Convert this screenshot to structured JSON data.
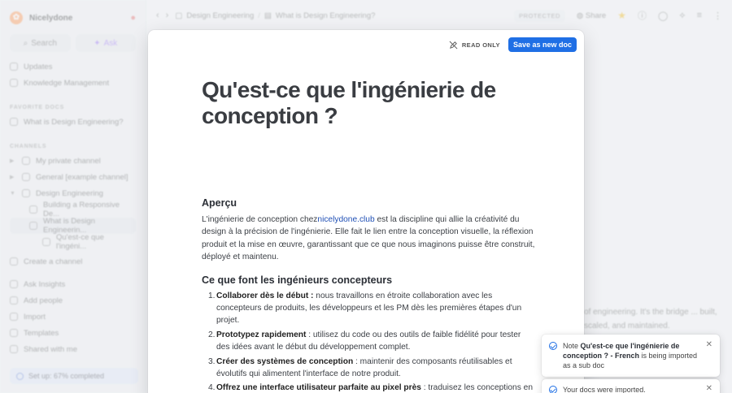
{
  "sidebar": {
    "brand": "Nicelydone",
    "search_label": "Search",
    "ask_label": "Ask",
    "nav": [
      {
        "label": "Updates"
      },
      {
        "label": "Knowledge Management"
      }
    ],
    "favorites_title": "FAVORITE DOCS",
    "favorites": [
      {
        "label": "What is Design Engineering?"
      }
    ],
    "channels_title": "CHANNELS",
    "channels": [
      {
        "label": "My private channel"
      },
      {
        "label": "General [example channel]"
      },
      {
        "label": "Design Engineering"
      }
    ],
    "subdocs": [
      {
        "label": "Building a Responsive De..."
      },
      {
        "label": "What is Design Engineerin..."
      },
      {
        "label": "Qu'est-ce que l'ingéni..."
      }
    ],
    "create_channel": "Create a channel",
    "bottom_items": [
      {
        "label": "Ask Insights"
      },
      {
        "label": "Add people"
      },
      {
        "label": "Import"
      },
      {
        "label": "Templates"
      },
      {
        "label": "Shared with me"
      }
    ],
    "setup": {
      "label": "Set up: 67% completed",
      "progress_percent": 67
    }
  },
  "topbar": {
    "crumb_channel": "Design Engineering",
    "crumb_doc": "What is Design Engineering?",
    "protected": "PROTECTED",
    "share": "Share"
  },
  "background_text": "of engineering. It's the bridge ... built, scaled, and maintained.",
  "modal": {
    "readonly": "READ ONLY",
    "save_button": "Save as new doc",
    "title": "Qu'est-ce que l'ingénierie de conception ?",
    "overview_heading": "Aperçu",
    "overview_pre": "L'ingénierie de conception chez",
    "overview_link": "nicelydone.club",
    "overview_post": " est la discipline qui allie la créativité du design à la précision de l'ingénierie. Elle fait le lien entre la conception visuelle, la réflexion produit et la mise en œuvre, garantissant que ce que nous imaginons puisse être construit, déployé et maintenu.",
    "role_heading": "Ce que font les ingénieurs concepteurs",
    "items": [
      {
        "num": "1.",
        "bold": "Collaborer dès le début :",
        "text": " nous travaillons en étroite collaboration avec les concepteurs de produits, les développeurs et les PM dès les premières étapes d'un projet."
      },
      {
        "num": "2.",
        "bold": "Prototypez rapidement",
        "text": " : utilisez du code ou des outils de faible fidélité pour tester des idées avant le début du développement complet."
      },
      {
        "num": "3.",
        "bold": "Créer des systèmes de conception",
        "text": " : maintenir des composants réutilisables et évolutifs qui alimentent l'interface de notre produit."
      },
      {
        "num": "4.",
        "bold": "Offrez une interface utilisateur parfaite au pixel près",
        "text": " : traduisez les conceptions en code de haute qualité, accessible et performant."
      }
    ]
  },
  "toasts": [
    {
      "pre": "Note ",
      "bold": "Qu'est-ce que l'ingénierie de conception ? - French",
      "post": " is being imported as a sub doc"
    },
    {
      "pre": "Your docs were imported.",
      "bold": "",
      "post": ""
    }
  ],
  "colors": {
    "accent": "#1f6fe5",
    "brand": "#ff8a3d",
    "star": "#f2b400"
  }
}
